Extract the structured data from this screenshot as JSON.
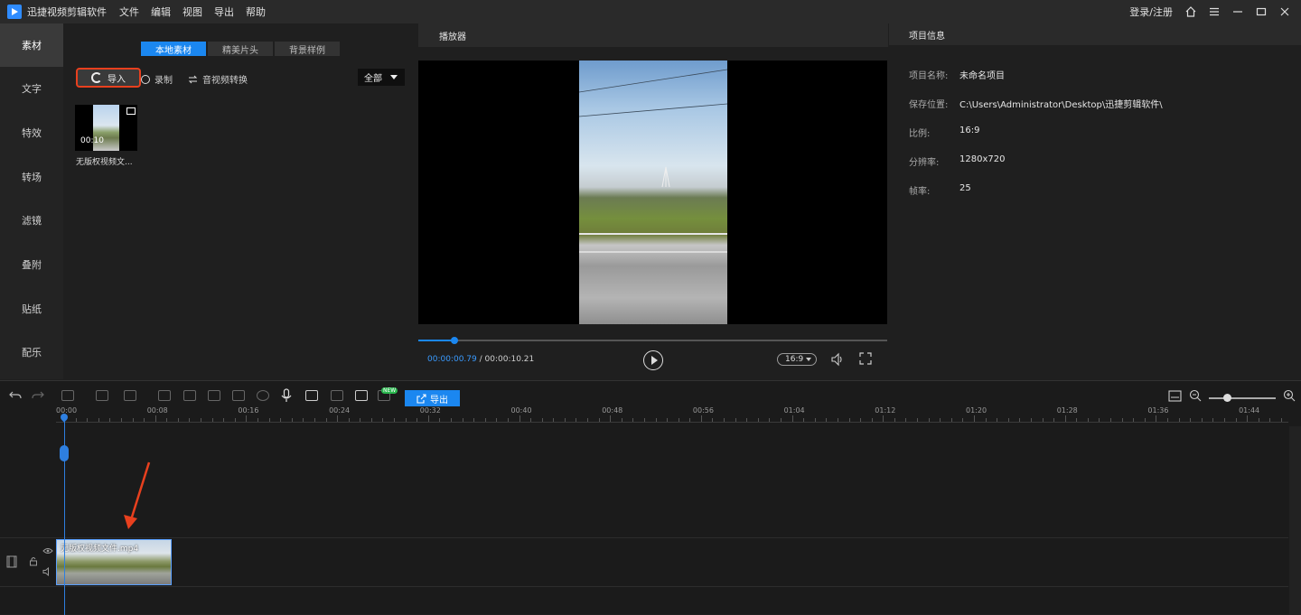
{
  "titlebar": {
    "app_name": "迅捷视频剪辑软件",
    "menu": [
      "文件",
      "编辑",
      "视图",
      "导出",
      "帮助"
    ],
    "login": "登录/注册"
  },
  "left_rail": [
    {
      "label": "素材",
      "active": true
    },
    {
      "label": "文字",
      "active": false
    },
    {
      "label": "特效",
      "active": false
    },
    {
      "label": "转场",
      "active": false
    },
    {
      "label": "滤镜",
      "active": false
    },
    {
      "label": "叠附",
      "active": false
    },
    {
      "label": "贴纸",
      "active": false
    },
    {
      "label": "配乐",
      "active": false
    }
  ],
  "media": {
    "tabs": [
      {
        "label": "本地素材",
        "active": true
      },
      {
        "label": "精美片头",
        "active": false
      },
      {
        "label": "背景样例",
        "active": false
      }
    ],
    "import_label": "导入",
    "record_label": "录制",
    "convert_label": "音视频转换",
    "filter_value": "全部",
    "items": [
      {
        "duration": "00:10",
        "name": "无版权视频文..."
      }
    ]
  },
  "player": {
    "title": "播放器",
    "current_time": "00:00:00.79",
    "total_time": "/ 00:00:10.21",
    "progress": 0.077,
    "ratio": "16:9"
  },
  "info": {
    "title": "项目信息",
    "rows": [
      {
        "key": "项目名称:",
        "value": "未命名项目"
      },
      {
        "key": "保存位置:",
        "value": "C:\\Users\\Administrator\\Desktop\\迅捷剪辑软件\\"
      },
      {
        "key": "比例:",
        "value": "16:9"
      },
      {
        "key": "分辨率:",
        "value": "1280x720"
      },
      {
        "key": "帧率:",
        "value": "25"
      }
    ]
  },
  "timeline": {
    "export_label": "导出",
    "new_badge": "NEW",
    "ruler": [
      "00:00",
      "00:08",
      "00:16",
      "00:24",
      "00:32",
      "00:40",
      "00:48",
      "00:56",
      "01:04",
      "01:12",
      "01:20",
      "01:28",
      "01:36",
      "01:44"
    ],
    "clip_name": "无版权视频文件.mp4"
  },
  "colors": {
    "accent": "#1b87f0",
    "highlight": "#e8401e"
  }
}
